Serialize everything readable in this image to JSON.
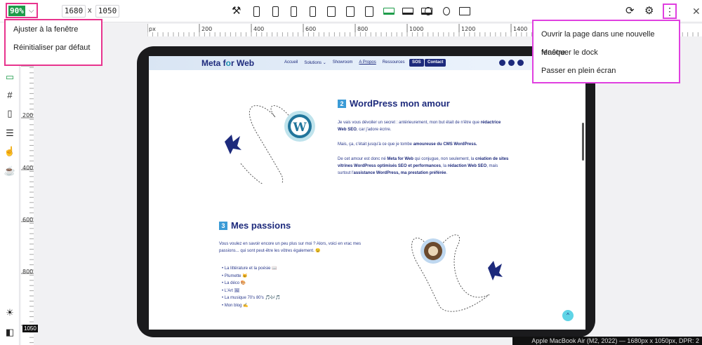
{
  "toolbar": {
    "zoom": "90%",
    "width": "1680",
    "separator": "x",
    "height": "1050",
    "accent_color": "#1e9c4a",
    "icons": [
      "tools-icon",
      "phone-icon",
      "phone-icon",
      "phone-icon",
      "phone-icon",
      "tablet-icon",
      "tablet-icon",
      "tablet-icon",
      "laptop-icon",
      "laptop-icon",
      "laptop-icon",
      "watch-icon",
      "watch-icon",
      "monitor-icon",
      "reload-icon",
      "gear-icon",
      "kebab-icon"
    ],
    "active_device": "laptop-icon"
  },
  "zoom_menu": {
    "items": [
      "Ajuster à la fenêtre",
      "Réinitialiser par défaut"
    ],
    "highlight_color": "#e8348e"
  },
  "more_menu": {
    "items": [
      "Ouvrir la page dans une nouvelle fenêtre",
      "Masquer le dock",
      "Passer en plein écran"
    ],
    "highlight_color": "#e040e0"
  },
  "ruler": {
    "h_unit": "px",
    "h_labels": [
      "200",
      "400",
      "600",
      "800",
      "1000",
      "1200",
      "1400"
    ],
    "v_labels": [
      "200",
      "400",
      "600",
      "800"
    ],
    "size_badge": "1050"
  },
  "status": "Apple MacBook Air (M2, 2022) — 1680px x 1050px, DPR: 2",
  "site": {
    "logo_a": "Meta f",
    "logo_o": "o",
    "logo_b": "r Web",
    "nav": [
      "Accueil",
      "Solutions ⌄",
      "Showroom",
      "A Propos",
      "Ressources"
    ],
    "nav_active": "A Propos",
    "btn_sos": "SOS",
    "btn_contact": "Contact",
    "brand_color": "#1d2a7c",
    "s2_num": "2",
    "s2_title": "WordPress mon amour",
    "s2_p1a": "Je vais vous dévoiler un secret : antérieurement, mon but était de n'être que",
    "s2_p1b": "rédactrice Web SEO",
    "s2_p1c": ", car j'adore écrire.",
    "s2_p2a": "Mais, ça, c'était jusqu'à ce que je tombe ",
    "s2_p2b": "amoureuse du CMS WordPress.",
    "s2_p3a": "De cet amour est donc né ",
    "s2_p3b": "Meta for Web",
    "s2_p3c": " qui conjugue, non seulement, la ",
    "s2_p3d": "création de sites vitrines WordPress optimisés SEO et performances",
    "s2_p3e": ", la ",
    "s2_p3f": "rédaction Web SEO",
    "s2_p3g": ", mais surtout l'",
    "s2_p3h": "assistance WordPress, ma prestation préférée",
    "s2_p3i": ".",
    "s3_num": "3",
    "s3_title": "Mes passions",
    "s3_p1": "Vous voulez en savoir encore un peu plus sur moi ? Alors, voici en vrac mes passions... qui sont peut-être les vôtres également. 😉",
    "passions": [
      "La littérature et la poésie 📖",
      "Plumette 🐱",
      "La déco 🎨",
      "L'Art 🖼",
      "La musique 70's 80's 🎵🎶🎵",
      "Mon blog ✍"
    ],
    "totop": "^"
  }
}
